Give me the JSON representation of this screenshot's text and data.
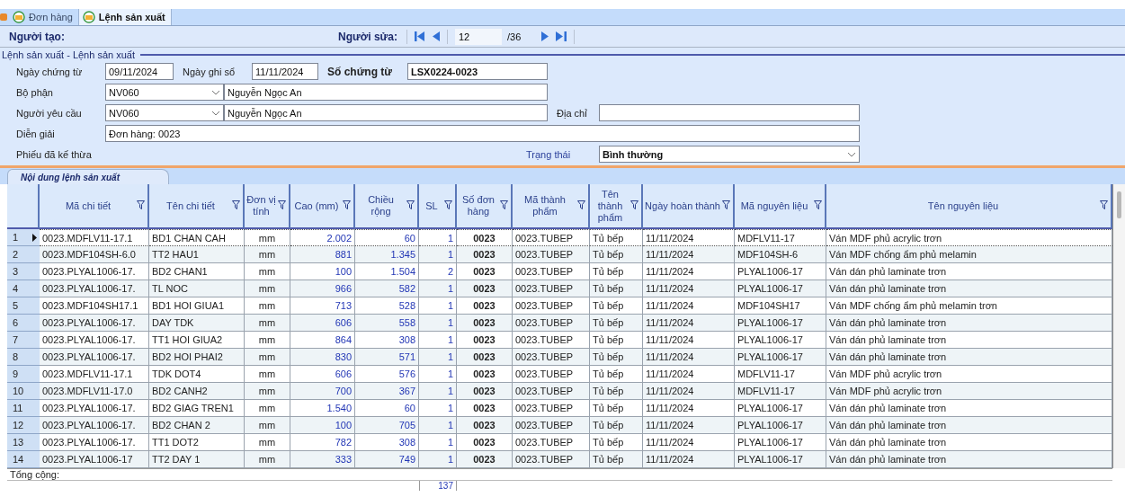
{
  "tabs": [
    {
      "label": "Đơn hàng",
      "selected": false
    },
    {
      "label": "Lệnh sản xuất",
      "selected": true
    }
  ],
  "toolbar": {
    "creator_label": "Người tạo:",
    "editor_label": "Người sửa:",
    "record": "12",
    "record_total": "/36"
  },
  "section_title": "Lệnh sản xuất - Lệnh sản xuất",
  "form": {
    "doc_date_label": "Ngày chứng từ",
    "doc_date": "09/11/2024",
    "post_date_label": "Ngày ghi sổ",
    "post_date": "11/11/2024",
    "doc_no_label": "Số chứng từ",
    "doc_no": "LSX0224-0023",
    "department_label": "Bộ phận",
    "department_code": "NV060",
    "department_name": "Nguyễn Ngọc An",
    "requester_label": "Người yêu cầu",
    "requester_code": "NV060",
    "requester_name": "Nguyễn Ngọc An",
    "address_label": "Địa chỉ",
    "description_label": "Diễn giải",
    "description": "Đơn hàng: 0023",
    "inherited_label": "Phiếu đã kế thừa",
    "status_label": "Trạng thái",
    "status": "Bình thường"
  },
  "grid": {
    "tab": "Nội dung lệnh sản xuất",
    "columns": [
      {
        "label": "Mã  chi tiết",
        "kind": "text"
      },
      {
        "label": "Tên chi tiết",
        "kind": "text"
      },
      {
        "label": "Đơn vị tính",
        "kind": "center"
      },
      {
        "label": "Cao (mm)",
        "kind": "number"
      },
      {
        "label": "Chiều rộng",
        "kind": "number"
      },
      {
        "label": "SL",
        "kind": "number"
      },
      {
        "label": "Số đơn hàng",
        "kind": "bold"
      },
      {
        "label": "Mã thành phẩm",
        "kind": "text"
      },
      {
        "label": "Tên thành phẩm",
        "kind": "text"
      },
      {
        "label": "Ngày hoàn thành",
        "kind": "text"
      },
      {
        "label": "Mã nguyên liệu",
        "kind": "text"
      },
      {
        "label": "Tên nguyên liệu",
        "kind": "text"
      }
    ],
    "rows": [
      {
        "no": "1",
        "selected": true,
        "cells": [
          "0023.MDFLV11-17.1",
          "BD1 CHAN CAH",
          "mm",
          "2.002",
          "60",
          "1",
          "0023",
          "0023.TUBEP",
          "Tủ bếp",
          "11/11/2024",
          "MDFLV11-17",
          "Ván MDF phủ acrylic trơn"
        ]
      },
      {
        "no": "2",
        "selected": false,
        "cells": [
          "0023.MDF104SH-6.0",
          "TT2 HAU1",
          "mm",
          "881",
          "1.345",
          "1",
          "0023",
          "0023.TUBEP",
          "Tủ bếp",
          "11/11/2024",
          "MDF104SH-6",
          "Ván MDF chống ẩm phủ melamin"
        ]
      },
      {
        "no": "3",
        "selected": false,
        "cells": [
          "0023.PLYAL1006-17.",
          "BD2 CHAN1",
          "mm",
          "100",
          "1.504",
          "2",
          "0023",
          "0023.TUBEP",
          "Tủ bếp",
          "11/11/2024",
          "PLYAL1006-17",
          "Ván dán phủ laminate trơn"
        ]
      },
      {
        "no": "4",
        "selected": false,
        "cells": [
          "0023.PLYAL1006-17.",
          "TL NOC",
          "mm",
          "966",
          "582",
          "1",
          "0023",
          "0023.TUBEP",
          "Tủ bếp",
          "11/11/2024",
          "PLYAL1006-17",
          "Ván dán phủ laminate trơn"
        ]
      },
      {
        "no": "5",
        "selected": false,
        "cells": [
          "0023.MDF104SH17.1",
          "BD1 HOI GIUA1",
          "mm",
          "713",
          "528",
          "1",
          "0023",
          "0023.TUBEP",
          "Tủ bếp",
          "11/11/2024",
          "MDF104SH17",
          "Ván MDF chống ẩm phủ melamin trơn"
        ]
      },
      {
        "no": "6",
        "selected": false,
        "cells": [
          "0023.PLYAL1006-17.",
          "DAY TDK",
          "mm",
          "606",
          "558",
          "1",
          "0023",
          "0023.TUBEP",
          "Tủ bếp",
          "11/11/2024",
          "PLYAL1006-17",
          "Ván dán phủ laminate trơn"
        ]
      },
      {
        "no": "7",
        "selected": false,
        "cells": [
          "0023.PLYAL1006-17.",
          "TT1 HOI GIUA2",
          "mm",
          "864",
          "308",
          "1",
          "0023",
          "0023.TUBEP",
          "Tủ bếp",
          "11/11/2024",
          "PLYAL1006-17",
          "Ván dán phủ laminate trơn"
        ]
      },
      {
        "no": "8",
        "selected": false,
        "cells": [
          "0023.PLYAL1006-17.",
          "BD2 HOI PHAI2",
          "mm",
          "830",
          "571",
          "1",
          "0023",
          "0023.TUBEP",
          "Tủ bếp",
          "11/11/2024",
          "PLYAL1006-17",
          "Ván dán phủ laminate trơn"
        ]
      },
      {
        "no": "9",
        "selected": false,
        "cells": [
          "0023.MDFLV11-17.1",
          "TDK DOT4",
          "mm",
          "606",
          "576",
          "1",
          "0023",
          "0023.TUBEP",
          "Tủ bếp",
          "11/11/2024",
          "MDFLV11-17",
          "Ván MDF phủ acrylic trơn"
        ]
      },
      {
        "no": "10",
        "selected": false,
        "cells": [
          "0023.MDFLV11-17.0",
          "BD2 CANH2",
          "mm",
          "700",
          "367",
          "1",
          "0023",
          "0023.TUBEP",
          "Tủ bếp",
          "11/11/2024",
          "MDFLV11-17",
          "Ván MDF phủ acrylic trơn"
        ]
      },
      {
        "no": "11",
        "selected": false,
        "cells": [
          "0023.PLYAL1006-17.",
          "BD2 GIAG TREN1",
          "mm",
          "1.540",
          "60",
          "1",
          "0023",
          "0023.TUBEP",
          "Tủ bếp",
          "11/11/2024",
          "PLYAL1006-17",
          "Ván dán phủ laminate trơn"
        ]
      },
      {
        "no": "12",
        "selected": false,
        "cells": [
          "0023.PLYAL1006-17.",
          "BD2 CHAN 2",
          "mm",
          "100",
          "705",
          "1",
          "0023",
          "0023.TUBEP",
          "Tủ bếp",
          "11/11/2024",
          "PLYAL1006-17",
          "Ván dán phủ laminate trơn"
        ]
      },
      {
        "no": "13",
        "selected": false,
        "cells": [
          "0023.PLYAL1006-17.",
          "TT1 DOT2",
          "mm",
          "782",
          "308",
          "1",
          "0023",
          "0023.TUBEP",
          "Tủ bếp",
          "11/11/2024",
          "PLYAL1006-17",
          "Ván dán phủ laminate trơn"
        ]
      },
      {
        "no": "14",
        "selected": false,
        "cells": [
          "0023.PLYAL1006-17",
          "TT2 DAY 1",
          "mm",
          "333",
          "749",
          "1",
          "0023",
          "0023.TUBEP",
          "Tủ bếp",
          "11/11/2024",
          "PLYAL1006-17",
          "Ván dán phủ laminate trơn"
        ]
      }
    ],
    "footer_label": "Tổng cộng:",
    "total_sl": "137"
  }
}
